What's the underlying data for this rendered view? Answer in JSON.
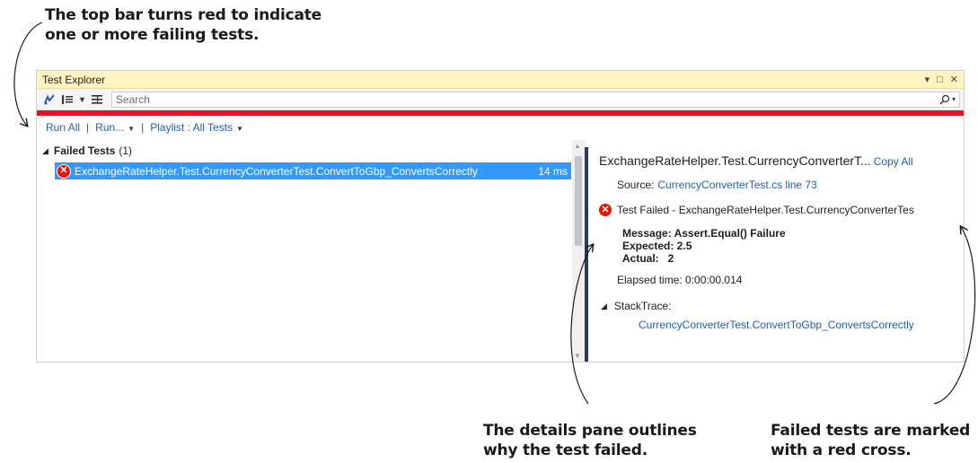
{
  "annotations": {
    "top_bar_lines": [
      "The top bar turns red to indicate",
      "one or more failing tests."
    ],
    "details_lines": [
      "The details pane outlines",
      "why the test failed."
    ],
    "cross_lines": [
      "Failed tests are marked",
      "with a red cross."
    ]
  },
  "window": {
    "title": "Test Explorer",
    "controls": {
      "dropdown": "▾",
      "maximize": "□",
      "close": "✕"
    }
  },
  "toolbar": {
    "icons": [
      "run-tests-icon",
      "group-by-icon",
      "list-view-icon"
    ],
    "search_placeholder": "Search",
    "search_icon": "search-icon"
  },
  "status": {
    "color": "#e81123",
    "state": "failing"
  },
  "commands": {
    "run_all": "Run All",
    "run": "Run...",
    "playlist": "Playlist : All Tests"
  },
  "groups": [
    {
      "title": "Failed Tests",
      "count": "(1)",
      "tests": [
        {
          "name": "ExchangeRateHelper.Test.CurrencyConverterTest.ConvertToGbp_ConvertsCorrectly",
          "duration": "14 ms",
          "status": "failed"
        }
      ]
    }
  ],
  "details": {
    "title": "ExchangeRateHelper.Test.CurrencyConverterT...",
    "copy_all": "Copy All",
    "source_label": "Source:",
    "source_link": "CurrencyConverterTest.cs line 73",
    "failed_text": "Test Failed - ExchangeRateHelper.Test.CurrencyConverterTes",
    "message": "Message: Assert.Equal() Failure",
    "expected": "Expected: 2.5",
    "actual": "Actual:   2",
    "elapsed": "Elapsed time: 0:00:00.014",
    "stacktrace_label": "StackTrace:",
    "stacktrace_line": "CurrencyConverterTest.ConvertToGbp_ConvertsCorrectly"
  },
  "colors": {
    "accent_link": "#1e5fb4",
    "selection": "#3399ff",
    "titlebar": "#fdf4bf",
    "fail_red": "#e51400"
  }
}
